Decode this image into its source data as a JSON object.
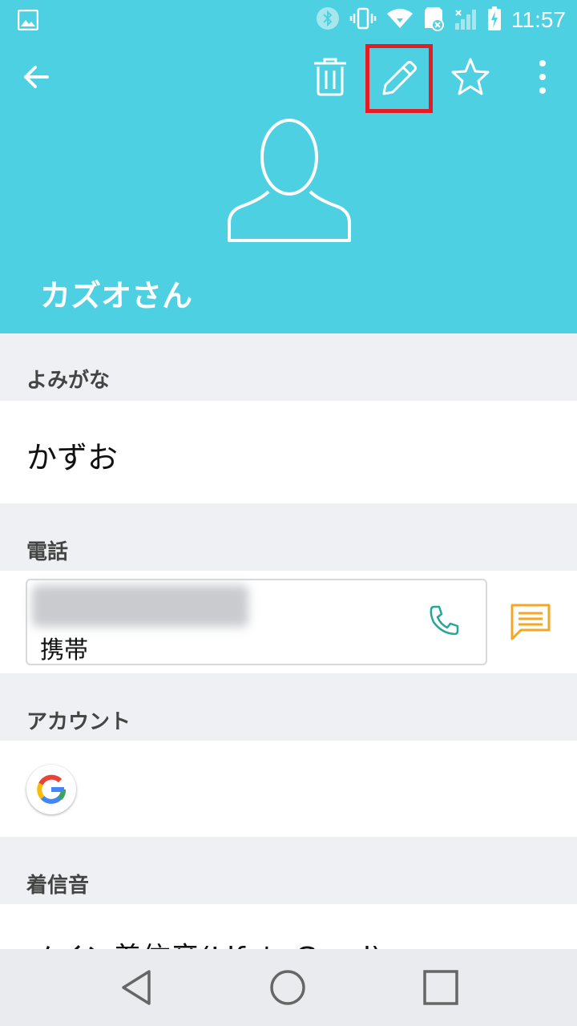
{
  "status_bar": {
    "time": "11:57",
    "icons": [
      "image-icon",
      "bluetooth-icon",
      "vibrate-icon",
      "wifi-icon",
      "sd-card-icon",
      "no-signal-icon",
      "battery-charging-icon"
    ]
  },
  "toolbar": {
    "icons": [
      "back-arrow-icon",
      "trash-icon",
      "pencil-icon",
      "star-icon",
      "more-vert-icon"
    ]
  },
  "contact": {
    "name": "カズオさん"
  },
  "sections": {
    "yomigana": {
      "label": "よみがな",
      "value": "かずお"
    },
    "phone": {
      "label": "電話",
      "type": "携帯"
    },
    "account": {
      "label": "アカウント",
      "icon": "google-icon"
    },
    "ringtone": {
      "label": "着信音",
      "value": "メイン着信音(Life's Good)"
    }
  },
  "colors": {
    "header": "#4dd0e1",
    "highlight": "#e51c23",
    "call": "#26a69a",
    "sms": "#f5a623"
  }
}
